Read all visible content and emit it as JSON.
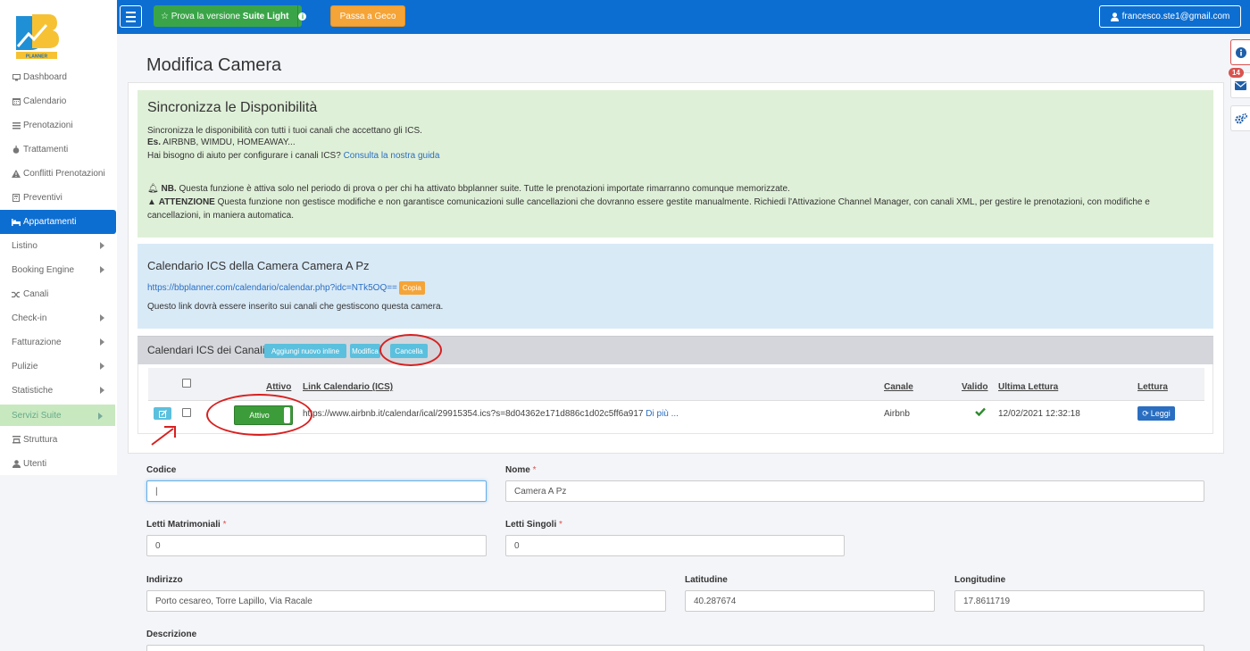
{
  "brand": {
    "name": "bbplanner",
    "logo_text": "PLANNER"
  },
  "sidebar": {
    "items": [
      {
        "label": "Dashboard",
        "icon": "monitor-icon"
      },
      {
        "label": "Calendario",
        "icon": "calendar-icon"
      },
      {
        "label": "Prenotazioni",
        "icon": "list-icon"
      },
      {
        "label": "Trattamenti",
        "icon": "apple-icon"
      },
      {
        "label": "Conflitti Prenotazioni",
        "icon": "warning-icon"
      },
      {
        "label": "Preventivi",
        "icon": "calculator-icon"
      },
      {
        "label": "Appartamenti",
        "icon": "bed-icon"
      },
      {
        "label": "Listino"
      },
      {
        "label": "Booking Engine"
      },
      {
        "label": "Canali",
        "icon": "shuffle-icon"
      },
      {
        "label": "Check-in"
      },
      {
        "label": "Fatturazione"
      },
      {
        "label": "Pulizie"
      },
      {
        "label": "Statistiche"
      },
      {
        "label": "Servizi Suite"
      },
      {
        "label": "Struttura",
        "icon": "building-icon"
      },
      {
        "label": "Utenti",
        "icon": "user-icon"
      }
    ]
  },
  "topbar": {
    "suite_prefix": "Prova la versione",
    "suite_bold": "Suite Light",
    "geco_label": "Passa a Geco",
    "user_email": "francesco.ste1@gmail.com"
  },
  "dock": {
    "badge_count": "14"
  },
  "page": {
    "title": "Modifica Camera"
  },
  "sync": {
    "title": "Sincronizza le Disponibilità",
    "line1": "Sincronizza le disponibilità con tutti i tuoi canali che accettano gli ICS.",
    "example_label": "Es.",
    "example_value": "AIRBNB, WIMDU, HOMEAWAY...",
    "help_text": "Hai bisogno di aiuto per configurare i canali ICS?",
    "help_link": "Consulta la nostra guida",
    "nb_label": "NB.",
    "nb_text": "Questa funzione è attiva solo nel periodo di prova o per chi ha attivato bbplanner suite. Tutte le prenotazioni importate rimarranno comunque memorizzate.",
    "warn_label": "ATTENZIONE",
    "warn_text": "Questa funzione non gestisce modifiche e non garantisce comunicazioni sulle cancellazioni che dovranno essere gestite manualmente. Richiedi l'Attivazione Channel Manager, con canali XML, per gestire le prenotazioni, con modifiche e",
    "warn_text2": "cancellazioni, in maniera automatica."
  },
  "ics_room": {
    "title": "Calendario ICS della Camera Camera A Pz",
    "url": "https://bbplanner.com/calendario/calendar.php?idc=NTk5OQ==",
    "copy_label": "Copia",
    "note": "Questo link dovrà essere inserito sui canali che gestiscono questa camera."
  },
  "ics_channels": {
    "title": "Calendari ICS dei Canali",
    "add_label": "Aggiungi nuovo inline",
    "edit_label": "Modifica",
    "cancel_label": "Cancella",
    "columns": {
      "attivo": "Attivo",
      "link": "Link Calendario (ICS)",
      "canale": "Canale",
      "valido": "Valido",
      "ultima": "Ultima Lettura",
      "lettura": "Lettura"
    },
    "rows": [
      {
        "status": "Attivo",
        "link": "https://www.airbnb.it/calendar/ical/29915354.ics?s=8d04362e171d886c1d02c5ff6a917",
        "more": "Di più ...",
        "channel": "Airbnb",
        "last_read": "12/02/2021 12:32:18",
        "read_label": "Leggi"
      }
    ]
  },
  "form": {
    "codice_label": "Codice",
    "codice_value": "|",
    "nome_label": "Nome",
    "nome_value": "Camera A Pz",
    "letti_matr_label": "Letti Matrimoniali",
    "letti_matr_value": "0",
    "letti_sing_label": "Letti Singoli",
    "letti_sing_value": "0",
    "indirizzo_label": "Indirizzo",
    "indirizzo_value": "Porto cesareo, Torre Lapillo, Via Racale",
    "lat_label": "Latitudine",
    "lat_value": "40.287674",
    "lon_label": "Longitudine",
    "lon_value": "17.8611719",
    "descr_label": "Descrizione",
    "required_mark": "*"
  },
  "colors": {
    "primary": "#0d6ed1",
    "success": "#3aa548",
    "warning": "#f5a437",
    "info": "#5bc0de",
    "annotation": "#d82020"
  }
}
